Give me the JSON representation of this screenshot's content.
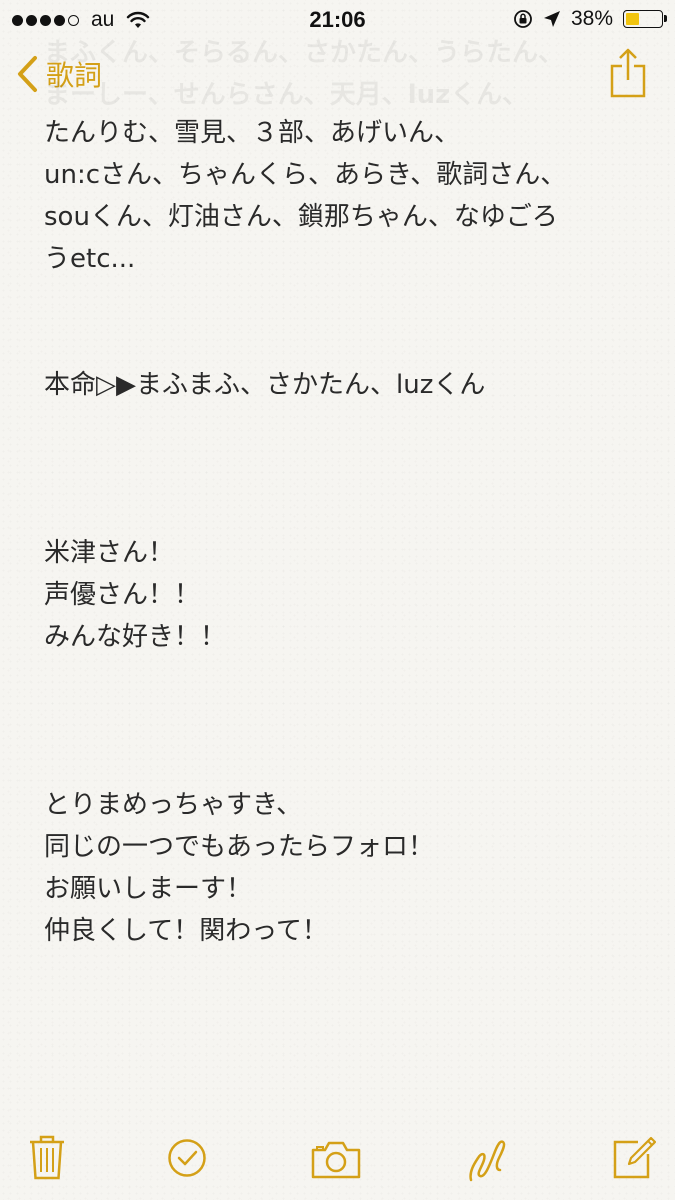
{
  "status_bar": {
    "carrier": "au",
    "time": "21:06",
    "battery_percent": "38%",
    "battery_level": 0.38,
    "battery_color": "#f1c40f"
  },
  "nav": {
    "back_label": "歌詞",
    "accent_color": "#d4a017"
  },
  "note": {
    "ghost_lines": "まふくん、そらるん、さかたん、うらたん、\nまーしー、せんらさん、天月、luzくん、",
    "lines": [
      "たんりむ、雪見、３部、あげいん、",
      "un:cさん、ちゃんくら、あらき、歌詞さん、",
      "souくん、灯油さん、鎖那ちゃん、なゆごろ",
      "うetc...",
      "本命▷▶まふまふ、さかたん、luzくん",
      "米津さん！",
      "声優さん！！",
      "みんな好き！！",
      "とりまめっちゃすき、",
      "同じの一つでもあったらフォロ！",
      "お願いしまーす！",
      "仲良くして！関わって！"
    ]
  },
  "toolbar": {
    "icons": [
      "trash-icon",
      "checklist-icon",
      "camera-icon",
      "sketch-icon",
      "compose-icon"
    ]
  }
}
